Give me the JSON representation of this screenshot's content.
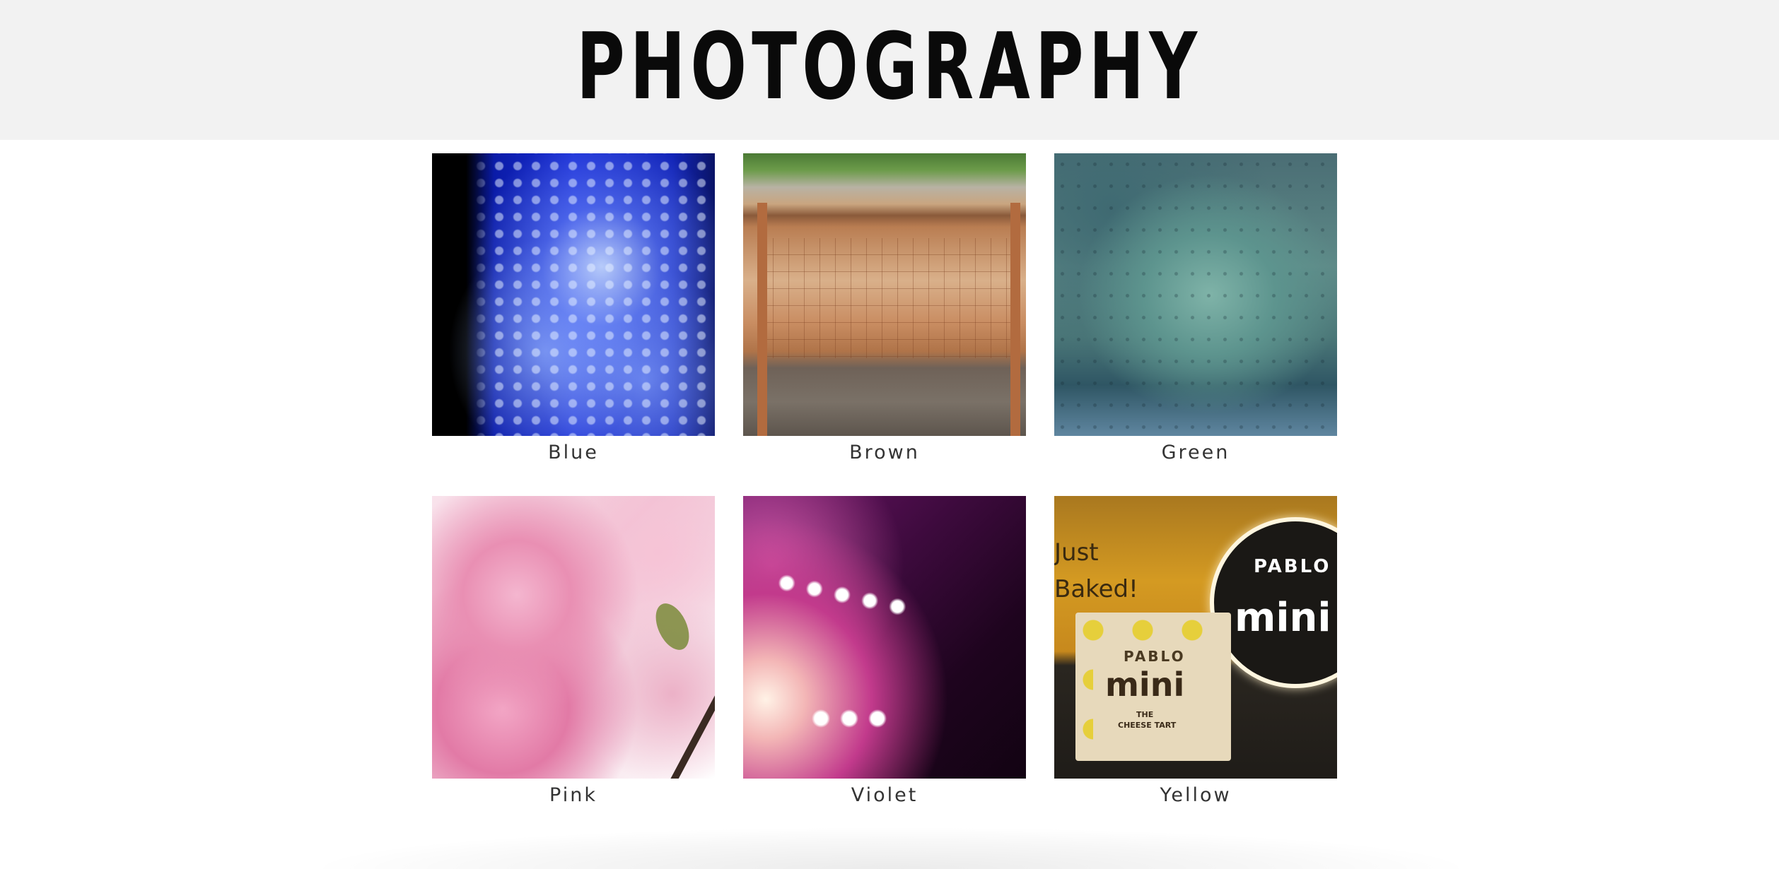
{
  "header": {
    "title": "PHOTOGRAPHY",
    "background": "#f2f2f2"
  },
  "gallery": [
    {
      "label": "Blue",
      "photo_icon": "jellyfish-photo"
    },
    {
      "label": "Brown",
      "photo_icon": "ema-board-photo"
    },
    {
      "label": "Green",
      "photo_icon": "rainy-window-photo"
    },
    {
      "label": "Pink",
      "photo_icon": "cherry-blossom-photo"
    },
    {
      "label": "Violet",
      "photo_icon": "stage-lights-photo"
    },
    {
      "label": "Yellow",
      "photo_icon": "pablo-mini-photo"
    }
  ],
  "yellow_photo_text": {
    "sign_top": "PABLO",
    "sign_main": "mini",
    "wall_line1": "Just",
    "wall_line2": "Baked!",
    "bag_top": "PABLO",
    "bag_main": "mini",
    "bag_line1": "THE",
    "bag_line2": "CHEESE TART"
  }
}
